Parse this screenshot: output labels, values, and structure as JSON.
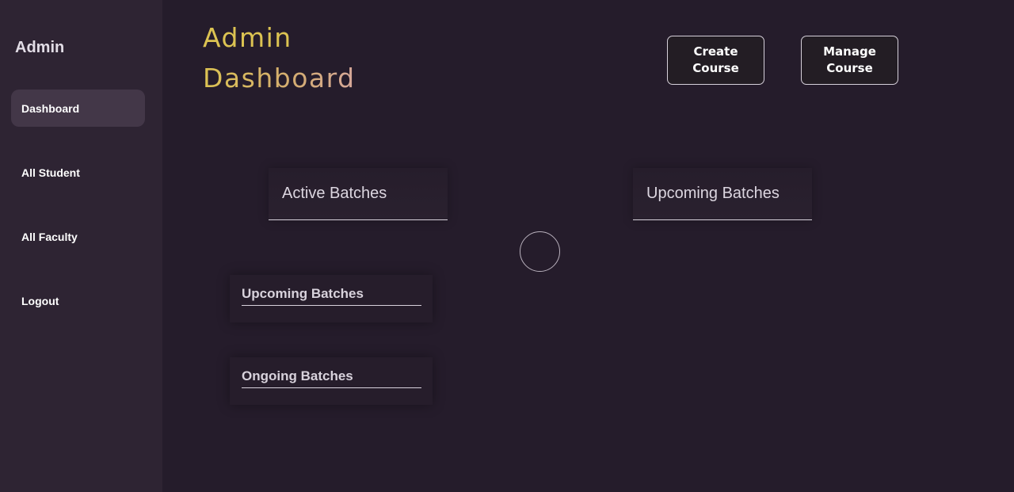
{
  "sidebar": {
    "title": "Admin",
    "items": [
      {
        "label": "Dashboard",
        "active": true
      },
      {
        "label": "All Student",
        "active": false
      },
      {
        "label": "All Faculty",
        "active": false
      },
      {
        "label": "Logout",
        "active": false
      }
    ]
  },
  "header": {
    "title_line1": "Admin",
    "title_line2": "Dashboard",
    "buttons": {
      "create_course": "Create Course",
      "manage_course": "Manage Course"
    }
  },
  "tabs": [
    {
      "label": "Active Batches"
    },
    {
      "label": "Upcoming Batches"
    }
  ],
  "sections": [
    {
      "label": "Upcoming Batches"
    },
    {
      "label": "Ongoing Batches"
    }
  ],
  "colors": {
    "background": "#251c2b",
    "sidebar": "#2e2433",
    "active_nav": "#433748",
    "title_gold": "#dcc352"
  }
}
